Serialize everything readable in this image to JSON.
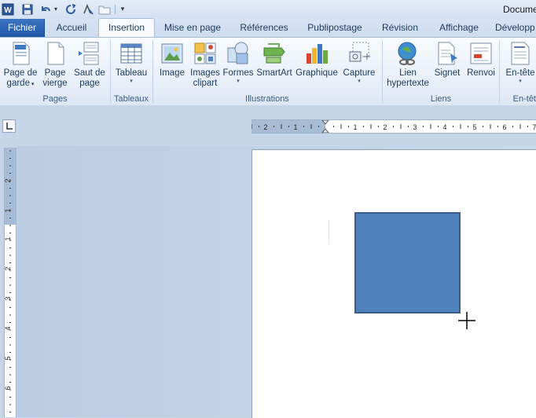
{
  "window": {
    "title": "Docume"
  },
  "quick_access": {
    "icons": [
      "word-app-icon",
      "save-icon",
      "undo-icon",
      "redo-icon",
      "format-painter-icon",
      "folder-icon",
      "customize-icon"
    ]
  },
  "tabs": [
    {
      "label": "Fichier"
    },
    {
      "label": "Accueil"
    },
    {
      "label": "Insertion"
    },
    {
      "label": "Mise en page"
    },
    {
      "label": "Références"
    },
    {
      "label": "Publipostage"
    },
    {
      "label": "Révision"
    },
    {
      "label": "Affichage"
    },
    {
      "label": "Développ"
    }
  ],
  "active_tab": "Insertion",
  "ribbon": {
    "groups": {
      "pages": {
        "label": "Pages",
        "buttons": {
          "cover": [
            "Page de",
            "garde"
          ],
          "blank": [
            "Page",
            "vierge"
          ],
          "break": [
            "Saut de",
            "page"
          ]
        }
      },
      "tables": {
        "label": "Tableaux",
        "buttons": {
          "table": "Tableau"
        }
      },
      "illustrations": {
        "label": "Illustrations",
        "buttons": {
          "image": "Image",
          "clipart": [
            "Images",
            "clipart"
          ],
          "shapes": "Formes",
          "smartart": "SmartArt",
          "chart": "Graphique",
          "screenshot": "Capture"
        }
      },
      "links": {
        "label": "Liens",
        "buttons": {
          "hyperlink": [
            "Lien",
            "hypertexte"
          ],
          "bookmark": "Signet",
          "crossref": "Renvoi"
        }
      },
      "header": {
        "label": "En-têt",
        "buttons": {
          "header": "En-tête"
        }
      }
    }
  },
  "ruler": {
    "horizontal_labels": [
      "2",
      "1",
      "1",
      "2",
      "3",
      "4",
      "5",
      "6",
      "7"
    ],
    "vertical_labels": [
      "2",
      "1",
      "1",
      "2",
      "3",
      "4",
      "5",
      "6"
    ]
  },
  "colors": {
    "shape_fill": "#4f81bd",
    "shape_border": "#385d8a",
    "file_tab": "#2a5fae"
  }
}
